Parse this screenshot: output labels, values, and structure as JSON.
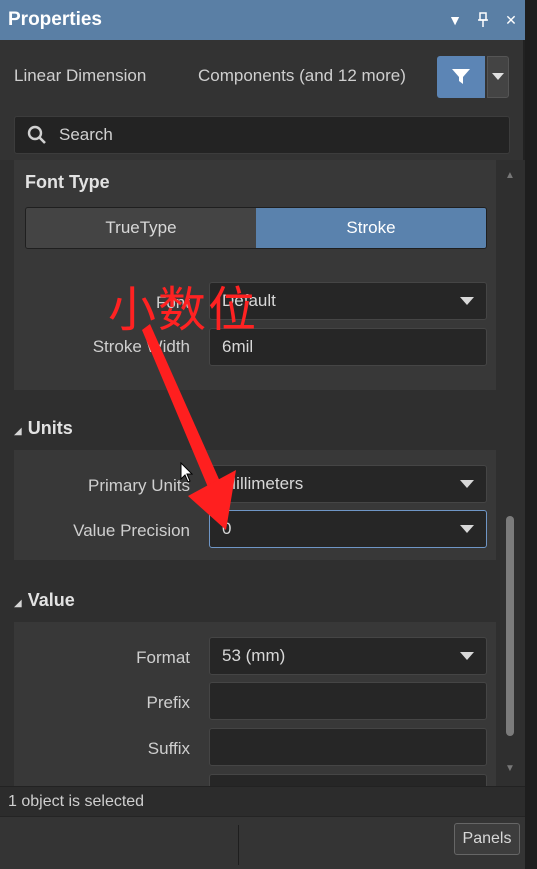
{
  "window": {
    "title": "Properties",
    "controls": [
      "menu-down",
      "pin",
      "close"
    ]
  },
  "filter": {
    "object_type": "Linear Dimension",
    "scope": "Components (and 12 more)",
    "filter_icon": "filter-icon"
  },
  "search": {
    "placeholder": "Search"
  },
  "font_type": {
    "heading": "Font Type",
    "options": [
      "TrueType",
      "Stroke"
    ],
    "selected": "Stroke",
    "font_label": "Font",
    "font_value": "Default",
    "stroke_width_label": "Stroke Width",
    "stroke_width_value": "6mil"
  },
  "units": {
    "heading": "Units",
    "primary_label": "Primary Units",
    "primary_value": "Millimeters",
    "precision_label": "Value Precision",
    "precision_value": "0"
  },
  "value": {
    "heading": "Value",
    "format_label": "Format",
    "format_value": "53 (mm)",
    "prefix_label": "Prefix",
    "prefix_value": "",
    "suffix_label": "Suffix",
    "suffix_value": ""
  },
  "annotation": {
    "text": "小数位",
    "color": "#ff2222"
  },
  "status": {
    "text": "1 object is selected"
  },
  "footer": {
    "panels_label": "Panels"
  },
  "colors": {
    "title_bar": "#5a7fa5",
    "accent": "#5a82ad",
    "focus_border": "#6f96c6"
  }
}
